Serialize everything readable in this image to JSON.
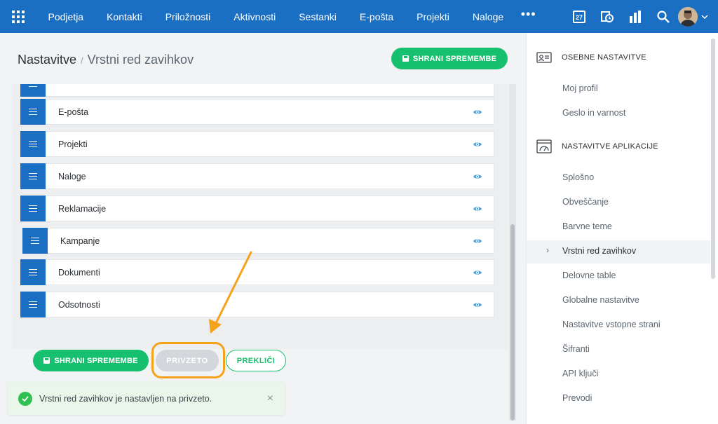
{
  "topbar": {
    "nav": [
      "Podjetja",
      "Kontakti",
      "Priložnosti",
      "Aktivnosti",
      "Sestanki",
      "E-pošta",
      "Projekti",
      "Naloge"
    ],
    "more": "•••",
    "calendar_day": "27",
    "bg_color": "#1a6fc2"
  },
  "breadcrumb": {
    "root": "Nastavitve",
    "separator": "/",
    "current": "Vrstni red zavihkov"
  },
  "buttons": {
    "save": "SHRANI SPREMEMBE",
    "default": "PRIVZETO",
    "cancel": "PREKLIČI"
  },
  "tabs": [
    {
      "label": "E-pošta"
    },
    {
      "label": "Projekti"
    },
    {
      "label": "Naloge"
    },
    {
      "label": "Reklamacije"
    },
    {
      "label": "Kampanje"
    },
    {
      "label": "Dokumenti"
    },
    {
      "label": "Odsotnosti"
    }
  ],
  "toast": {
    "message": "Vrstni red zavihkov je nastavljen na privzeto.",
    "close": "×"
  },
  "sidebar": {
    "section1": "OSEBNE NASTAVITVE",
    "personal": [
      "Moj profil",
      "Geslo in varnost"
    ],
    "section2": "NASTAVITVE APLIKACIJE",
    "app": [
      "Splošno",
      "Obveščanje",
      "Barvne teme",
      "Vrstni red zavihkov",
      "Delovne table",
      "Globalne nastavitve",
      "Nastavitve vstopne strani",
      "Šifranti",
      "API ključi",
      "Prevodi"
    ],
    "active_arrow": "›"
  },
  "colors": {
    "accent_green": "#17c06e",
    "highlight_orange": "#f5a21b",
    "handle_blue": "#1a6fc2"
  }
}
